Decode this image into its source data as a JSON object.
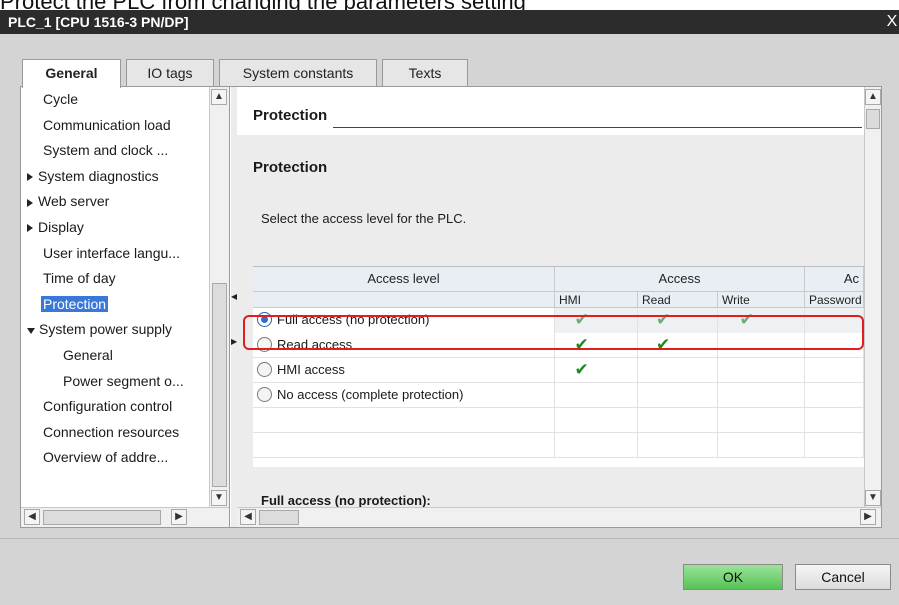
{
  "caption": "Protect the PLC from changing the parameters setting",
  "window": {
    "title": "PLC_1 [CPU 1516-3 PN/DP]",
    "close_glyph": "X"
  },
  "tabs": [
    {
      "label": "General",
      "active": true
    },
    {
      "label": "IO tags",
      "active": false
    },
    {
      "label": "System constants",
      "active": false
    },
    {
      "label": "Texts",
      "active": false
    }
  ],
  "nav": {
    "items": [
      {
        "label": "Cycle",
        "expander": "none",
        "indent": 0,
        "selected": false
      },
      {
        "label": "Communication load",
        "expander": "none",
        "indent": 0,
        "selected": false
      },
      {
        "label": "System and clock ...",
        "expander": "none",
        "indent": 0,
        "selected": false
      },
      {
        "label": "System diagnostics",
        "expander": "collapsed",
        "indent": 0,
        "selected": false
      },
      {
        "label": "Web server",
        "expander": "collapsed",
        "indent": 0,
        "selected": false
      },
      {
        "label": "Display",
        "expander": "collapsed",
        "indent": 0,
        "selected": false
      },
      {
        "label": "User interface langu...",
        "expander": "none",
        "indent": 0,
        "selected": false
      },
      {
        "label": "Time of day",
        "expander": "none",
        "indent": 0,
        "selected": false
      },
      {
        "label": "Protection",
        "expander": "none",
        "indent": 0,
        "selected": true
      },
      {
        "label": "System power supply",
        "expander": "expanded",
        "indent": 0,
        "selected": false
      },
      {
        "label": "General",
        "expander": "none",
        "indent": 1,
        "selected": false
      },
      {
        "label": "Power segment o...",
        "expander": "none",
        "indent": 1,
        "selected": false
      },
      {
        "label": "Configuration control",
        "expander": "none",
        "indent": 0,
        "selected": false
      },
      {
        "label": "Connection resources",
        "expander": "none",
        "indent": 0,
        "selected": false
      },
      {
        "label": "Overview of addre...",
        "expander": "none",
        "indent": 0,
        "selected": false
      }
    ]
  },
  "pane": {
    "header_title": "Protection",
    "section_title": "Protection",
    "instruction": "Select the access level for the PLC.",
    "subheading": "Full access (no protection):"
  },
  "access_table": {
    "headers": {
      "access_level": "Access level",
      "access": "Access",
      "access_truncated": "Ac"
    },
    "subheaders": [
      "HMI",
      "Read",
      "Write",
      "Password"
    ],
    "rows": [
      {
        "label": "Full access (no protection)",
        "selected": true,
        "hmi": true,
        "read": true,
        "write": true
      },
      {
        "label": "Read access",
        "selected": false,
        "hmi": true,
        "read": true,
        "write": false
      },
      {
        "label": "HMI access",
        "selected": false,
        "hmi": true,
        "read": false,
        "write": false
      },
      {
        "label": "No access (complete protection)",
        "selected": false,
        "hmi": false,
        "read": false,
        "write": false
      }
    ],
    "check_glyph": "✔"
  },
  "buttons": {
    "ok": "OK",
    "cancel": "Cancel"
  },
  "colors": {
    "titlebar": "#2c2c2c",
    "selection": "#3a78d8",
    "ok_button": "#6fd06f",
    "highlight_outline": "#e11d1d",
    "check_green": "#1e8a1e"
  }
}
